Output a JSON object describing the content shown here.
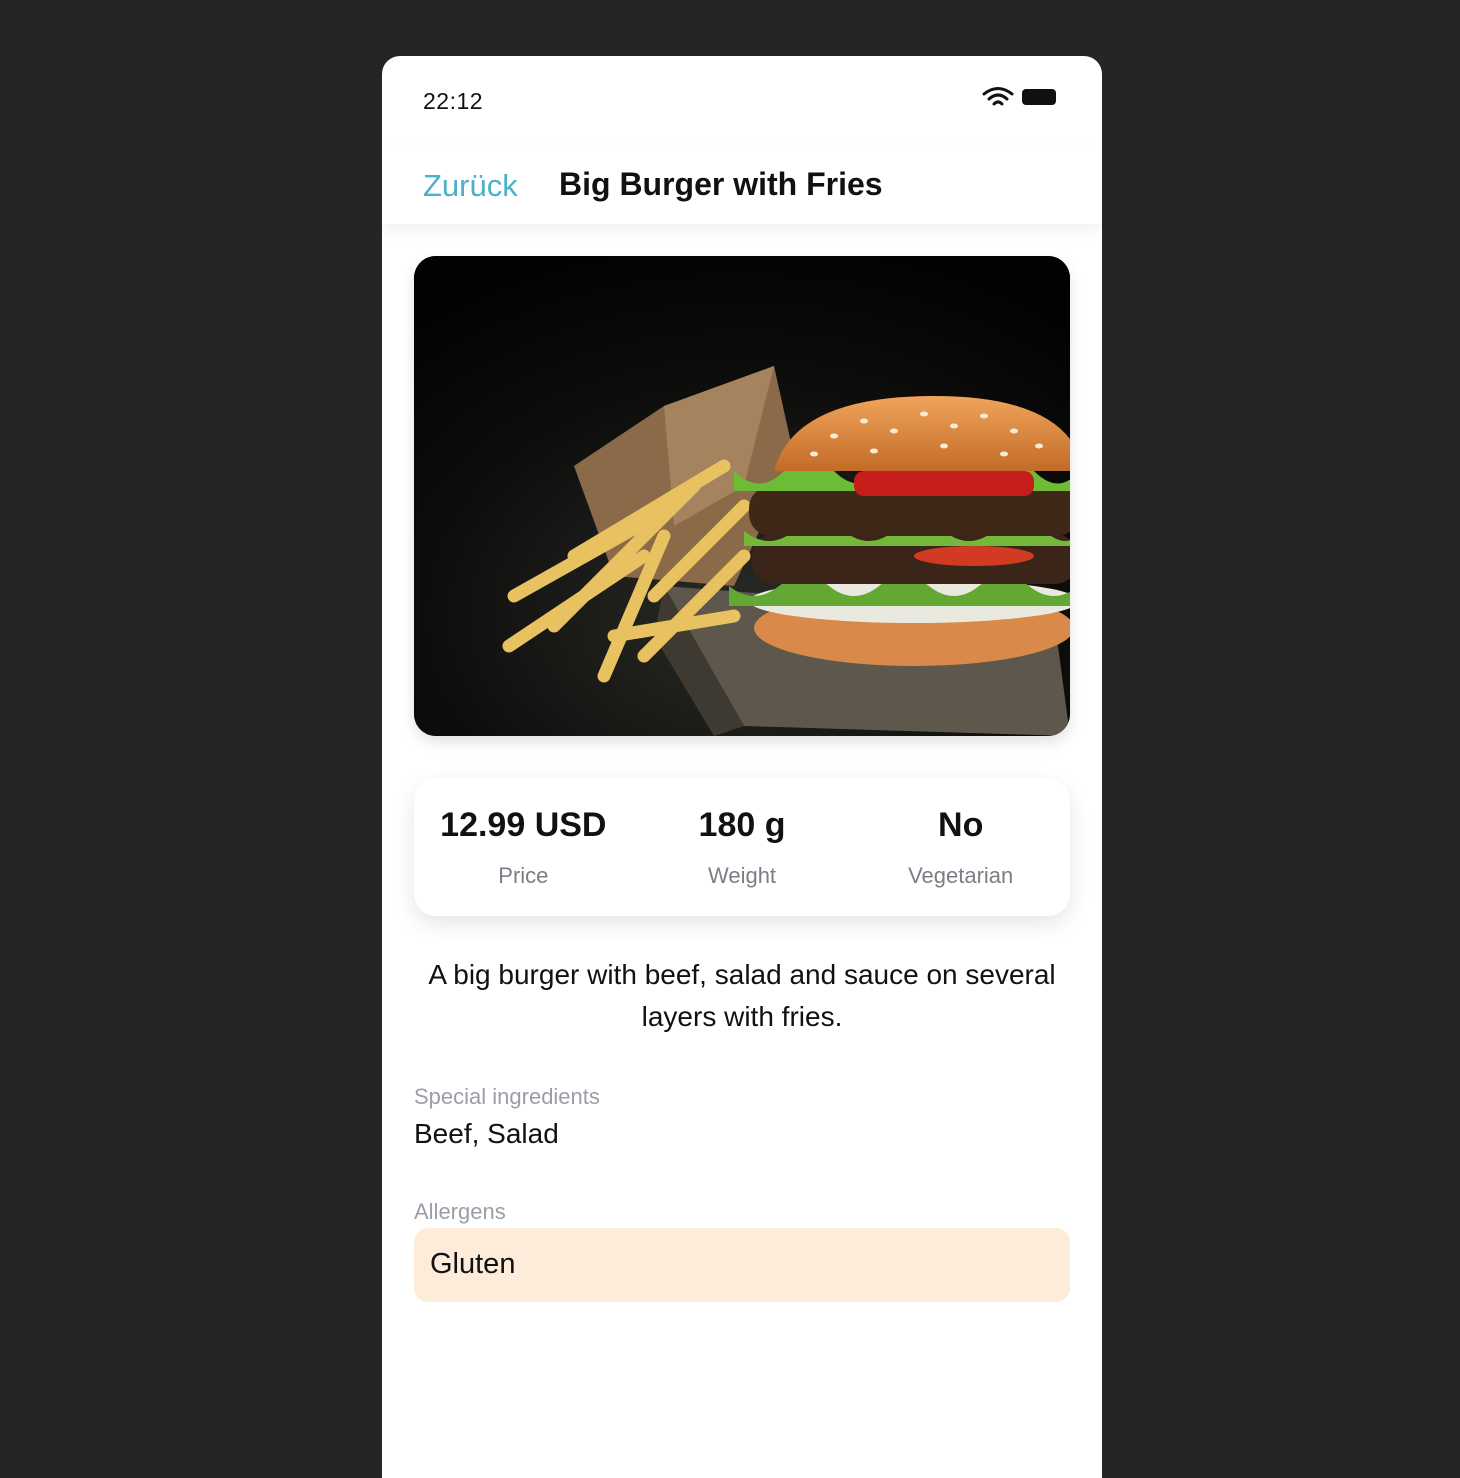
{
  "status_bar": {
    "time": "22:12",
    "icons": [
      "wifi-icon",
      "battery-icon"
    ]
  },
  "nav": {
    "back_label": "Zurück",
    "title": "Big Burger with Fries"
  },
  "hero": {
    "image": "burger-with-fries-photo"
  },
  "info": {
    "price_value": "12.99 USD",
    "price_label": "Price",
    "weight_value": "180 g",
    "weight_label": "Weight",
    "vegetarian_value": "No",
    "vegetarian_label": "Vegetarian"
  },
  "description": "A big burger with beef, salad and sauce on several layers with fries.",
  "ingredients": {
    "label": "Special ingredients",
    "value": "Beef, Salad"
  },
  "allergens": {
    "label": "Allergens",
    "items": [
      "Gluten"
    ]
  },
  "colors": {
    "accent": "#4cb0c9",
    "allergen_bg": "#fcecd9",
    "background": "#252527"
  }
}
